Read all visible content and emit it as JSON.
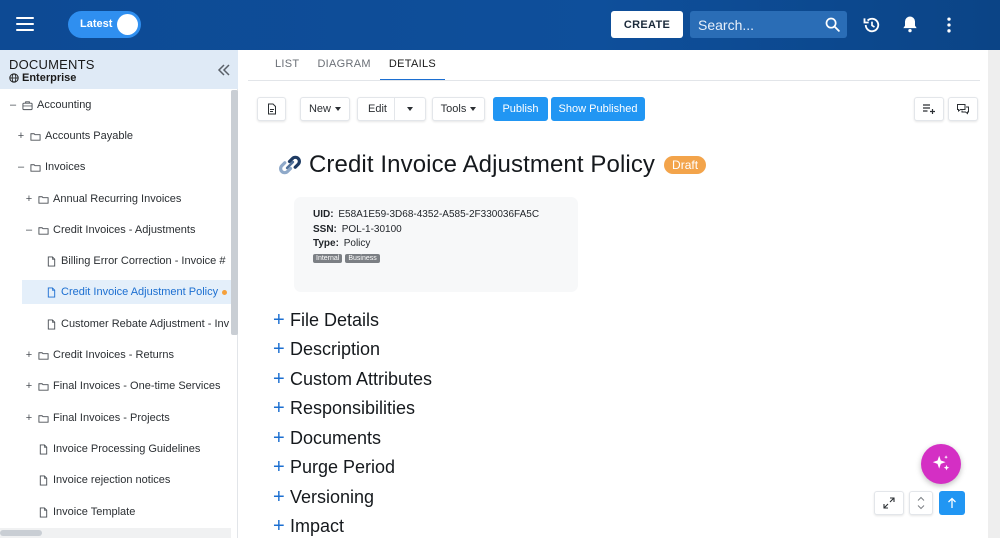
{
  "topbar": {
    "version_toggle_label": "Latest",
    "create_label": "CREATE",
    "search_placeholder": "Search...",
    "brand_color": "#0e4f9b",
    "icons": [
      "menu-icon",
      "search-icon",
      "history-icon",
      "bell-icon",
      "kebab-icon"
    ]
  },
  "sidebar": {
    "title": "DOCUMENTS",
    "subtitle": "Enterprise",
    "items": [
      {
        "label": "Accounting",
        "toggle": "–",
        "icon": "briefcase-icon"
      },
      {
        "label": "Accounts Payable",
        "toggle": "+",
        "icon": "folder-icon"
      },
      {
        "label": "Invoices",
        "toggle": "–",
        "icon": "folder-icon"
      },
      {
        "label": "Annual Recurring Invoices",
        "toggle": "+",
        "icon": "folder-icon"
      },
      {
        "label": "Credit Invoices - Adjustments",
        "toggle": "–",
        "icon": "folder-icon"
      },
      {
        "label": "Billing Error Correction - Invoice #",
        "toggle": "",
        "icon": "file-icon"
      },
      {
        "label": "Credit Invoice Adjustment Policy",
        "toggle": "",
        "icon": "file-icon",
        "active": true
      },
      {
        "label": "Customer Rebate Adjustment - Inv",
        "toggle": "",
        "icon": "file-icon"
      },
      {
        "label": "Credit Invoices - Returns",
        "toggle": "+",
        "icon": "folder-icon"
      },
      {
        "label": "Final Invoices - One-time Services",
        "toggle": "+",
        "icon": "folder-icon"
      },
      {
        "label": "Final Invoices - Projects",
        "toggle": "+",
        "icon": "folder-icon"
      },
      {
        "label": "Invoice Processing Guidelines",
        "toggle": "",
        "icon": "file-icon"
      },
      {
        "label": "Invoice rejection notices",
        "toggle": "",
        "icon": "file-icon"
      },
      {
        "label": "Invoice Template",
        "toggle": "",
        "icon": "file-icon"
      }
    ]
  },
  "tabs": [
    {
      "label": "LIST"
    },
    {
      "label": "DIAGRAM"
    },
    {
      "label": "DETAILS",
      "active": true
    }
  ],
  "toolbar": {
    "new_label": "New",
    "edit_label": "Edit",
    "tools_label": "Tools",
    "publish_label": "Publish",
    "show_published_label": "Show Published",
    "accent_color": "#2196f3"
  },
  "document": {
    "title": "Credit Invoice Adjustment Policy",
    "status": "Draft",
    "status_color": "#f3a44b",
    "uid_label": "UID:",
    "uid": "E58A1E59-3D68-4352-A585-2F330036FA5C",
    "ssn_label": "SSN:",
    "ssn": "POL-1-30100",
    "type_label": "Type:",
    "type": "Policy",
    "tags": [
      "Internal",
      "Business"
    ]
  },
  "sections": [
    {
      "label": "File Details"
    },
    {
      "label": "Description"
    },
    {
      "label": "Custom Attributes"
    },
    {
      "label": "Responsibilities"
    },
    {
      "label": "Documents"
    },
    {
      "label": "Purge Period"
    },
    {
      "label": "Versioning"
    },
    {
      "label": "Impact"
    }
  ]
}
